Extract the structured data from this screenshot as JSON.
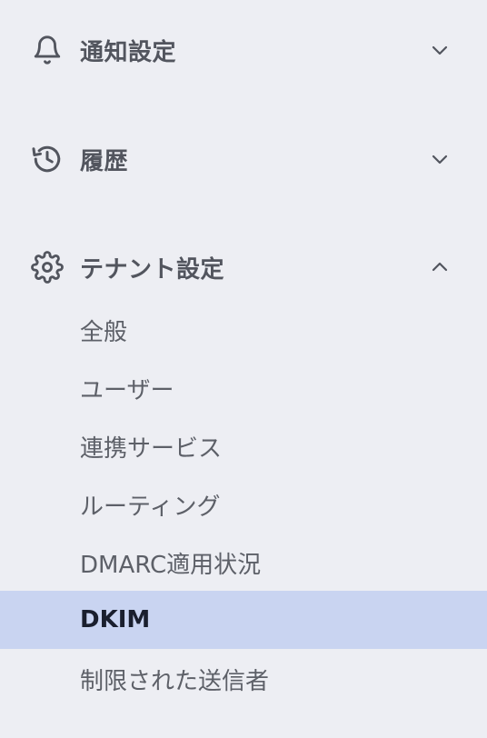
{
  "sections": [
    {
      "label": "通知設定",
      "icon": "bell-icon",
      "expanded": false
    },
    {
      "label": "履歴",
      "icon": "history-icon",
      "expanded": false
    },
    {
      "label": "テナント設定",
      "icon": "gear-icon",
      "expanded": true
    }
  ],
  "tenant_items": [
    {
      "label": "全般"
    },
    {
      "label": "ユーザー"
    },
    {
      "label": "連携サービス"
    },
    {
      "label": "ルーティング"
    },
    {
      "label": "DMARC適用状況"
    },
    {
      "label": "DKIM",
      "active": true
    },
    {
      "label": "制限された送信者"
    }
  ],
  "colors": {
    "background": "#edeef3",
    "active_background": "#c9d4f1",
    "label": "#52555e",
    "active_label": "#1a1f2e"
  }
}
